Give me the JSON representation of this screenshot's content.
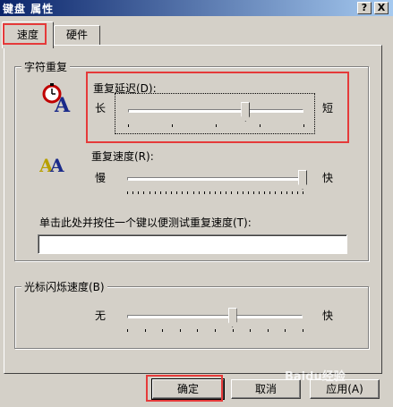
{
  "window": {
    "title": "键盘 属性",
    "help_button": "?",
    "close_button": "X"
  },
  "tabs": [
    {
      "label": "速度",
      "selected": true
    },
    {
      "label": "硬件",
      "selected": false
    }
  ],
  "repeat_group": {
    "title": "字符重复",
    "delay": {
      "label": "重复延迟(D):",
      "left_label": "长",
      "right_label": "短",
      "value_fraction": 0.67,
      "icon": "stopwatch-a-icon"
    },
    "rate": {
      "label": "重复速度(R):",
      "left_label": "慢",
      "right_label": "快",
      "value_fraction": 1.0,
      "icon": "repeating-a-icon"
    },
    "test": {
      "label": "单击此处并按住一个键以便测试重复速度(T):",
      "value": ""
    }
  },
  "cursor_group": {
    "title": "光标闪烁速度(B)",
    "left_label": "无",
    "right_label": "快",
    "value_fraction": 0.6
  },
  "buttons": {
    "ok": "确定",
    "cancel": "取消",
    "apply": "应用(A)"
  },
  "watermark": "Baidu经验",
  "colors": {
    "title_bar_start": "#0a246a",
    "title_bar_end": "#a6caf0",
    "face": "#d4d0c8",
    "highlight_box": "#e53a3a"
  }
}
